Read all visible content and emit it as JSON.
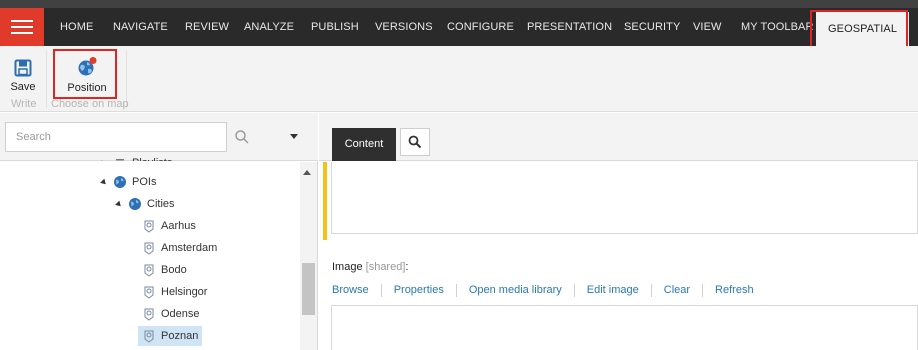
{
  "menu": {
    "tabs": [
      {
        "label": "HOME"
      },
      {
        "label": "NAVIGATE"
      },
      {
        "label": "REVIEW"
      },
      {
        "label": "ANALYZE"
      },
      {
        "label": "PUBLISH"
      },
      {
        "label": "VERSIONS"
      },
      {
        "label": "CONFIGURE"
      },
      {
        "label": "PRESENTATION"
      },
      {
        "label": "SECURITY"
      },
      {
        "label": "VIEW"
      },
      {
        "label": "MY TOOLBAR"
      },
      {
        "label": "GEOSPATIAL"
      }
    ],
    "active_tab": "GEOSPATIAL",
    "accent_color": "#e03a2a",
    "highlight_color": "#e02424"
  },
  "ribbon": {
    "save_label": "Save",
    "position_label": "Position",
    "group_write": "Write",
    "group_choose": "Choose on map"
  },
  "search": {
    "placeholder": "Search"
  },
  "tree": {
    "items": [
      {
        "label": "Playlists"
      },
      {
        "label": "POIs"
      },
      {
        "label": "Cities"
      },
      {
        "label": "Aarhus"
      },
      {
        "label": "Amsterdam"
      },
      {
        "label": "Bodo"
      },
      {
        "label": "Helsingor"
      },
      {
        "label": "Odense"
      },
      {
        "label": "Poznan"
      }
    ],
    "selected": "Poznan"
  },
  "editor": {
    "content_tab": "Content",
    "image_label": "Image",
    "image_shared": "[shared]",
    "image_colon": ":",
    "actions": [
      "Browse",
      "Properties",
      "Open media library",
      "Edit image",
      "Clear",
      "Refresh"
    ],
    "marker_color": "#f4c21a"
  }
}
